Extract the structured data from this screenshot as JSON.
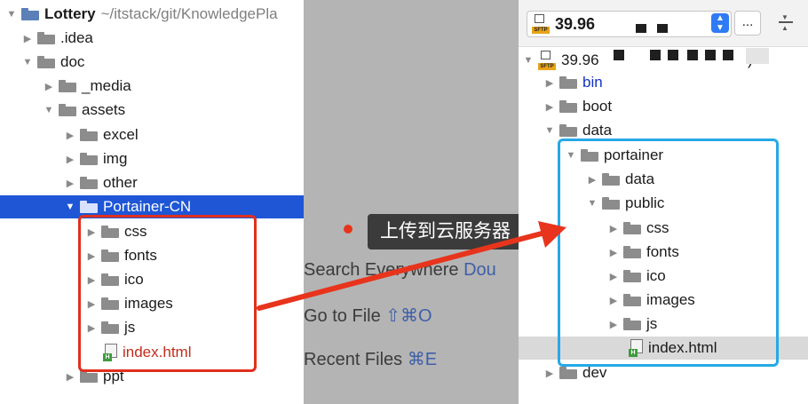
{
  "left_tree": {
    "root": {
      "name": "Lottery",
      "path": "~/itstack/git/KnowledgePla"
    },
    "idea": ".idea",
    "doc": "doc",
    "media": "_media",
    "assets": "assets",
    "excel": "excel",
    "img": "img",
    "other": "other",
    "portainer_cn": "Portainer-CN",
    "css": "css",
    "fonts": "fonts",
    "ico": "ico",
    "images": "images",
    "js": "js",
    "index": "index.html",
    "ppt": "ppt"
  },
  "search_popup": {
    "search_everywhere": "Search Everywhere",
    "search_everywhere_shortcut": "Dou",
    "go_to_file": "Go to File",
    "go_to_file_shortcut": "⇧⌘O",
    "recent_files": "Recent Files",
    "recent_files_shortcut": "⌘E"
  },
  "annotation": {
    "text": "上传到云服务器",
    "arrow_color": "#e8341c",
    "left_box_color": "#e0301e",
    "right_box_color": "#25a9e6"
  },
  "remote": {
    "server_select": "39.96",
    "more_button": "...",
    "root": "39.96",
    "root_suffix": ")",
    "sftp_tag": "SFTP",
    "bin": "bin",
    "boot": "boot",
    "data": "data",
    "portainer": "portainer",
    "pdata": "data",
    "public": "public",
    "css": "css",
    "fonts": "fonts",
    "ico": "ico",
    "images": "images",
    "js": "js",
    "index": "index.html",
    "dev": "dev"
  },
  "colors": {
    "selection": "#1e56d6",
    "folder": "#8c8c8c",
    "link_blue": "#1432c4",
    "file_red": "#c42b1c"
  }
}
